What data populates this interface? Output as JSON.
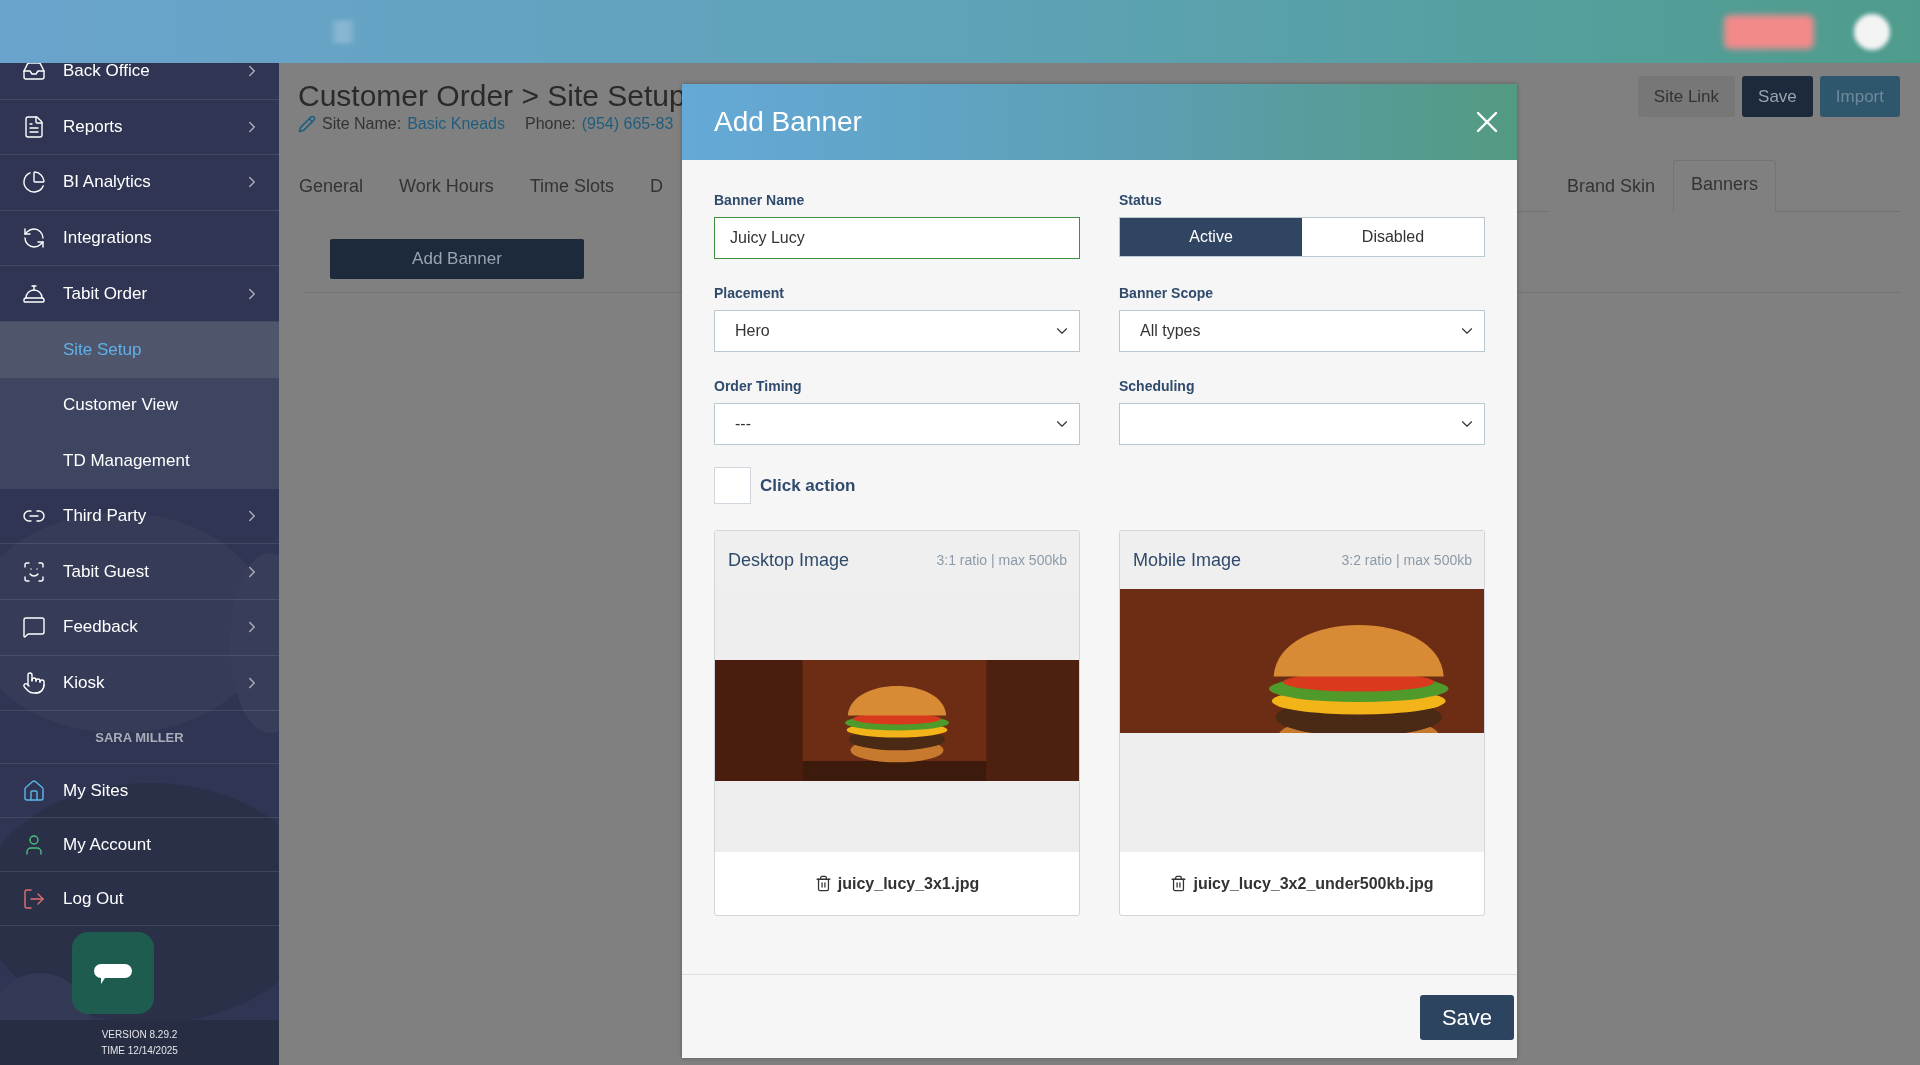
{
  "sidebar": {
    "items": [
      {
        "label": "Back Office",
        "has_submenu": true
      },
      {
        "label": "Reports",
        "has_submenu": true
      },
      {
        "label": "BI Analytics",
        "has_submenu": true
      },
      {
        "label": "Integrations",
        "has_submenu": false
      },
      {
        "label": "Tabit Order",
        "has_submenu": true,
        "children": [
          {
            "label": "Site Setup",
            "selected": true
          },
          {
            "label": "Customer View",
            "selected": false
          },
          {
            "label": "TD Management",
            "selected": false
          }
        ]
      },
      {
        "label": "Third Party",
        "has_submenu": true
      },
      {
        "label": "Tabit Guest",
        "has_submenu": true
      },
      {
        "label": "Feedback",
        "has_submenu": true
      },
      {
        "label": "Kiosk",
        "has_submenu": true
      }
    ],
    "user": {
      "name": "SARA MILLER",
      "items": [
        {
          "label": "My Sites"
        },
        {
          "label": "My Account"
        },
        {
          "label": "Log Out"
        }
      ]
    },
    "version": "VERSION 8.29.2",
    "time": "TIME 12/14/2025"
  },
  "page": {
    "title": "Customer Order > Site Setup",
    "site_name_label": "Site Name:",
    "site_name": "Basic Kneads",
    "phone_label": "Phone:",
    "phone": "(954) 665-83",
    "actions": [
      {
        "label": "Site Link",
        "kind": "secondary"
      },
      {
        "label": "Save",
        "kind": "primary"
      },
      {
        "label": "Import",
        "kind": "accent"
      }
    ],
    "tabs": [
      {
        "label": "General",
        "selected": false
      },
      {
        "label": "Work Hours",
        "selected": false
      },
      {
        "label": "Time Slots",
        "selected": false
      },
      {
        "label": "D",
        "selected": false
      },
      {
        "label": "Brand Skin",
        "selected": false
      },
      {
        "label": "Banners",
        "selected": true
      }
    ],
    "add_button": "Add Banner"
  },
  "modal": {
    "title": "Add Banner",
    "fields": [
      {
        "label": "Banner Name",
        "kind": "text",
        "value": "Juicy Lucy",
        "focused": true
      },
      {
        "label": "Status",
        "kind": "toggle",
        "options": [
          {
            "label": "Active",
            "selected": true
          },
          {
            "label": "Disabled",
            "selected": false
          }
        ]
      },
      {
        "label": "Placement",
        "kind": "select",
        "value": "Hero"
      },
      {
        "label": "Banner Scope",
        "kind": "select",
        "value": "All types"
      },
      {
        "label": "Order Timing",
        "kind": "select",
        "value": "---"
      },
      {
        "label": "Scheduling",
        "kind": "select"
      }
    ],
    "click_action": {
      "label": "Click action",
      "checked": false
    },
    "images": [
      {
        "title": "Desktop Image",
        "hint": "3:1 ratio | max 500kb",
        "file": "juicy_lucy_3x1.jpg",
        "kind": "wide"
      },
      {
        "title": "Mobile Image",
        "hint": "3:2 ratio | max 500kb",
        "file": "juicy_lucy_3x2_under500kb.jpg",
        "kind": "tall"
      }
    ],
    "save": "Save"
  }
}
